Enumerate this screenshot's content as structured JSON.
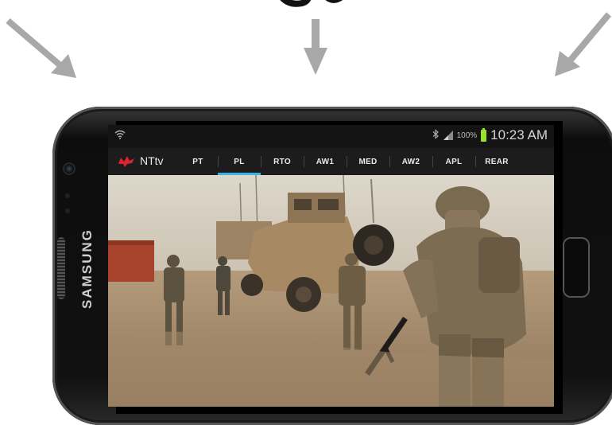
{
  "statusbar": {
    "battery_percent": "100%",
    "time": "10:23 AM"
  },
  "appbar": {
    "title": "NTtv",
    "tabs": [
      {
        "label": "PT",
        "active": false
      },
      {
        "label": "PL",
        "active": true
      },
      {
        "label": "RTO",
        "active": false
      },
      {
        "label": "AW1",
        "active": false
      },
      {
        "label": "MED",
        "active": false
      },
      {
        "label": "AW2",
        "active": false
      },
      {
        "label": "APL",
        "active": false
      },
      {
        "label": "REAR",
        "active": false
      }
    ]
  },
  "device": {
    "brand": "SAMSUNG"
  },
  "colors": {
    "accent": "#33b5e5",
    "battery": "#9be22b",
    "logo": "#d9232d",
    "arrow": "#a8a8a8"
  },
  "icons": [
    "wifi-icon",
    "bluetooth-icon",
    "signal-icon",
    "battery-icon",
    "app-logo-icon"
  ]
}
